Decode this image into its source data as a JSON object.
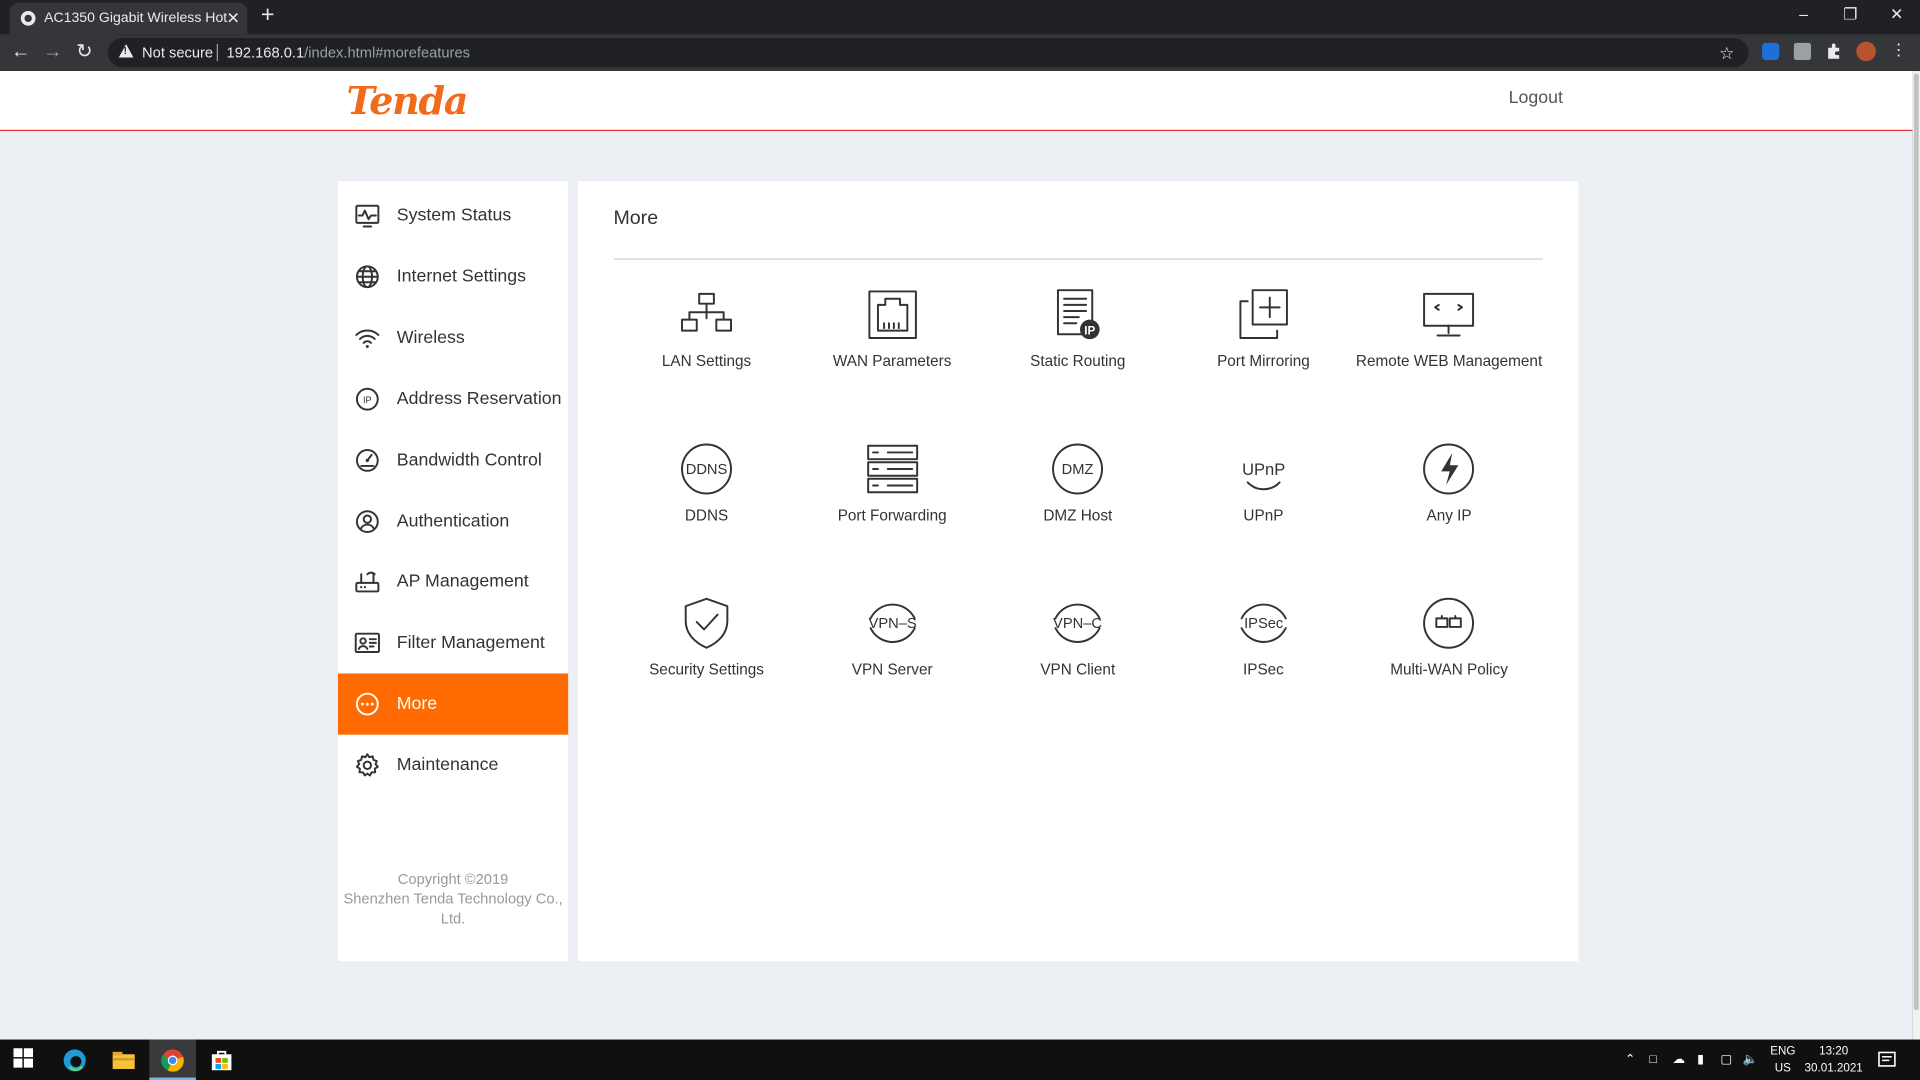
{
  "browser": {
    "tab_title": "AC1350 Gigabit Wireless Hotspot",
    "tab_close": "✕",
    "new_tab": "+",
    "security_label": "Not secure",
    "url_host": "192.168.0.1",
    "url_path": "/index.html#morefeatures",
    "window_controls": {
      "minimize": "–",
      "restore": "❐",
      "close": "✕"
    }
  },
  "header": {
    "brand": "Tenda",
    "logout": "Logout"
  },
  "sidebar": {
    "items": [
      {
        "label": "System Status",
        "icon": "pulse-monitor-icon",
        "active": false
      },
      {
        "label": "Internet Settings",
        "icon": "globe-icon",
        "active": false
      },
      {
        "label": "Wireless",
        "icon": "wifi-icon",
        "active": false
      },
      {
        "label": "Address Reservation",
        "icon": "ip-circle-icon",
        "active": false
      },
      {
        "label": "Bandwidth Control",
        "icon": "gauge-icon",
        "active": false
      },
      {
        "label": "Authentication",
        "icon": "user-circle-icon",
        "active": false
      },
      {
        "label": "AP Management",
        "icon": "access-point-icon",
        "active": false
      },
      {
        "label": "Filter Management",
        "icon": "id-card-icon",
        "active": false
      },
      {
        "label": "More",
        "icon": "more-dots-icon",
        "active": true
      },
      {
        "label": "Maintenance",
        "icon": "gear-icon",
        "active": false
      }
    ],
    "copyright": [
      "Copyright ©2019",
      "Shenzhen Tenda Technology Co.,",
      "Ltd."
    ]
  },
  "content": {
    "title": "More",
    "features": [
      {
        "label": "LAN Settings",
        "icon": "network-tree-icon"
      },
      {
        "label": "WAN Parameters",
        "icon": "ethernet-port-icon"
      },
      {
        "label": "Static Routing",
        "icon": "route-list-ip-icon"
      },
      {
        "label": "Port Mirroring",
        "icon": "mirror-plus-icon"
      },
      {
        "label": "Remote WEB Management",
        "icon": "remote-monitor-icon"
      },
      {
        "label": "DDNS",
        "icon": "ddns-icon",
        "icon_text": "DDNS"
      },
      {
        "label": "Port Forwarding",
        "icon": "server-rack-icon"
      },
      {
        "label": "DMZ Host",
        "icon": "dmz-icon",
        "icon_text": "DMZ"
      },
      {
        "label": "UPnP",
        "icon": "upnp-icon",
        "icon_text": "UPnP"
      },
      {
        "label": "Any IP",
        "icon": "lightning-icon"
      },
      {
        "label": "Security Settings",
        "icon": "shield-check-icon"
      },
      {
        "label": "VPN Server",
        "icon": "vpn-server-icon",
        "icon_text": "VPN–S"
      },
      {
        "label": "VPN Client",
        "icon": "vpn-client-icon",
        "icon_text": "VPN–C"
      },
      {
        "label": "IPSec",
        "icon": "ipsec-icon",
        "icon_text": "IPSec"
      },
      {
        "label": "Multi-WAN Policy",
        "icon": "multi-wan-icon"
      }
    ]
  },
  "taskbar": {
    "language": [
      "ENG",
      "US"
    ],
    "time": "13:20",
    "date": "30.01.2021"
  },
  "colors": {
    "accent": "#ff6b00",
    "brand": "#f26b1d",
    "header_rule": "#e53935",
    "page_bg": "#eceff3"
  }
}
